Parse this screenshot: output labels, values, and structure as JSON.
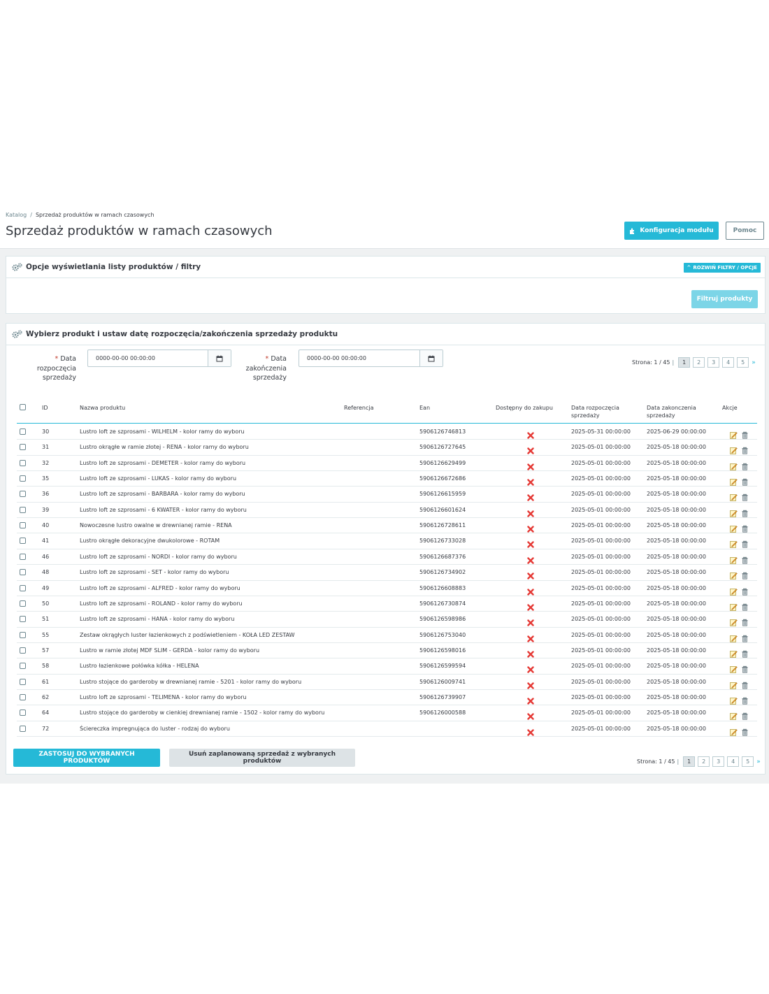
{
  "breadcrumb": {
    "root": "Katalog",
    "current": "Sprzedaż produktów w ramach czasowych"
  },
  "page": {
    "title": "Sprzedaż produktów w ramach czasowych"
  },
  "toolbar": {
    "config_label": "Konfiguracja modułu",
    "help_label": "Pomoc"
  },
  "filters_panel": {
    "title": "Opcje wyświetlania listy produktów / filtry",
    "expand_label": "ROZWIŃ FILTRY / OPCJE",
    "filter_button": "Filtruj produkty"
  },
  "products_panel": {
    "title": "Wybierz produkt i ustaw datę rozpoczęcia/zakończenia sprzedaży produktu",
    "start_label": {
      "l1": "Data",
      "l2": "rozpoczęcia",
      "l3": "sprzedaży"
    },
    "end_label": {
      "l1": "Data",
      "l2": "zakończenia",
      "l3": "sprzedaży"
    },
    "required_mark": "*",
    "start_value": "0000-00-00 00:00:00",
    "end_value": "0000-00-00 00:00:00"
  },
  "pagination": {
    "label": "Strona: 1 / 45",
    "separator": "|",
    "pages": [
      "1",
      "2",
      "3",
      "4",
      "5"
    ],
    "current": "1",
    "next": "»"
  },
  "table": {
    "headers": {
      "id": "ID",
      "name": "Nazwa produktu",
      "reference": "Referencja",
      "ean": "Ean",
      "available": "Dostępny do zakupu",
      "start": {
        "l1": "Data rozpoczęcia",
        "l2": "sprzedaży"
      },
      "end": {
        "l1": "Data zakonczenia",
        "l2": "sprzedaży"
      },
      "actions": "Akcje"
    },
    "rows": [
      {
        "id": "30",
        "name": "Lustro loft ze szprosami - WILHELM - kolor ramy do wyboru",
        "reference": "",
        "ean": "5906126746813",
        "start": "2025-05-31 00:00:00",
        "end": "2025-06-29 00:00:00"
      },
      {
        "id": "31",
        "name": "Lustro okrągłe w ramie złotej - RENA - kolor ramy do wyboru",
        "reference": "",
        "ean": "5906126727645",
        "start": "2025-05-01 00:00:00",
        "end": "2025-05-18 00:00:00"
      },
      {
        "id": "32",
        "name": "Lustro loft ze szprosami - DEMETER - kolor ramy do wyboru",
        "reference": "",
        "ean": "5906126629499",
        "start": "2025-05-01 00:00:00",
        "end": "2025-05-18 00:00:00"
      },
      {
        "id": "35",
        "name": "Lustro loft ze szprosami - LUKAS - kolor ramy do wyboru",
        "reference": "",
        "ean": "5906126672686",
        "start": "2025-05-01 00:00:00",
        "end": "2025-05-18 00:00:00"
      },
      {
        "id": "36",
        "name": "Lustro loft ze szprosami - BARBARA - kolor ramy do wyboru",
        "reference": "",
        "ean": "5906126615959",
        "start": "2025-05-01 00:00:00",
        "end": "2025-05-18 00:00:00"
      },
      {
        "id": "39",
        "name": "Lustro loft ze szprosami - 6 KWATER - kolor ramy do wyboru",
        "reference": "",
        "ean": "5906126601624",
        "start": "2025-05-01 00:00:00",
        "end": "2025-05-18 00:00:00"
      },
      {
        "id": "40",
        "name": "Nowoczesne lustro owalne w drewnianej ramie - RENA",
        "reference": "",
        "ean": "5906126728611",
        "start": "2025-05-01 00:00:00",
        "end": "2025-05-18 00:00:00"
      },
      {
        "id": "41",
        "name": "Lustro okrągłe dekoracyjne dwukolorowe - ROTAM",
        "reference": "",
        "ean": "5906126733028",
        "start": "2025-05-01 00:00:00",
        "end": "2025-05-18 00:00:00"
      },
      {
        "id": "46",
        "name": "Lustro loft ze szprosami - NORDI - kolor ramy do wyboru",
        "reference": "",
        "ean": "5906126687376",
        "start": "2025-05-01 00:00:00",
        "end": "2025-05-18 00:00:00"
      },
      {
        "id": "48",
        "name": "Lustro loft ze szprosami - SET - kolor ramy do wyboru",
        "reference": "",
        "ean": "5906126734902",
        "start": "2025-05-01 00:00:00",
        "end": "2025-05-18 00:00:00"
      },
      {
        "id": "49",
        "name": "Lustro loft ze szprosami - ALFRED - kolor ramy do wyboru",
        "reference": "",
        "ean": "5906126608883",
        "start": "2025-05-01 00:00:00",
        "end": "2025-05-18 00:00:00"
      },
      {
        "id": "50",
        "name": "Lustro loft ze szprosami - ROLAND - kolor ramy do wyboru",
        "reference": "",
        "ean": "5906126730874",
        "start": "2025-05-01 00:00:00",
        "end": "2025-05-18 00:00:00"
      },
      {
        "id": "51",
        "name": "Lustro loft ze szprosami - HANA - kolor ramy do wyboru",
        "reference": "",
        "ean": "5906126598986",
        "start": "2025-05-01 00:00:00",
        "end": "2025-05-18 00:00:00"
      },
      {
        "id": "55",
        "name": "Zestaw okrągłych luster łazienkowych z podświetleniem - KOŁA LED ZESTAW",
        "reference": "",
        "ean": "5906126753040",
        "start": "2025-05-01 00:00:00",
        "end": "2025-05-18 00:00:00"
      },
      {
        "id": "57",
        "name": "Lustro w ramie złotej MDF SLIM - GERDA - kolor ramy do wyboru",
        "reference": "",
        "ean": "5906126598016",
        "start": "2025-05-01 00:00:00",
        "end": "2025-05-18 00:00:00"
      },
      {
        "id": "58",
        "name": "Lustro łazienkowe połówka kółka - HELENA",
        "reference": "",
        "ean": "5906126599594",
        "start": "2025-05-01 00:00:00",
        "end": "2025-05-18 00:00:00"
      },
      {
        "id": "61",
        "name": "Lustro stojące do garderoby w drewnianej ramie - 5201 - kolor ramy do wyboru",
        "reference": "",
        "ean": "5906126009741",
        "start": "2025-05-01 00:00:00",
        "end": "2025-05-18 00:00:00"
      },
      {
        "id": "62",
        "name": "Lustro loft ze szprosami - TELIMENA - kolor ramy do wyboru",
        "reference": "",
        "ean": "5906126739907",
        "start": "2025-05-01 00:00:00",
        "end": "2025-05-18 00:00:00"
      },
      {
        "id": "64",
        "name": "Lustro stojące do garderoby w cienkiej drewnianej ramie - 1502 - kolor ramy do wyboru",
        "reference": "",
        "ean": "5906126000588",
        "start": "2025-05-01 00:00:00",
        "end": "2025-05-18 00:00:00"
      },
      {
        "id": "72",
        "name": "Ściereczka impregnująca do luster - rodzaj do wyboru",
        "reference": "",
        "ean": "",
        "start": "2025-05-01 00:00:00",
        "end": "2025-05-18 00:00:00"
      }
    ]
  },
  "footer": {
    "apply_label": "ZASTOSUJ DO WYBRANYCH PRODUKTÓW",
    "remove_label": "Usuń zaplanowaną sprzedaż z wybranych produktów"
  },
  "icons": {
    "gears": "gears-icon",
    "plugin": "puzzle-icon",
    "calendar": "calendar-icon",
    "unavailable": "x-mark-icon",
    "edit": "edit-icon",
    "delete": "trash-icon",
    "expand": "chevron-up-icon"
  },
  "colors": {
    "primary": "#25b9d7",
    "primary_disabled": "#7cd5e7",
    "danger": "#e53935",
    "text": "#363a41",
    "muted": "#6c868e",
    "background": "#eff1f2"
  }
}
